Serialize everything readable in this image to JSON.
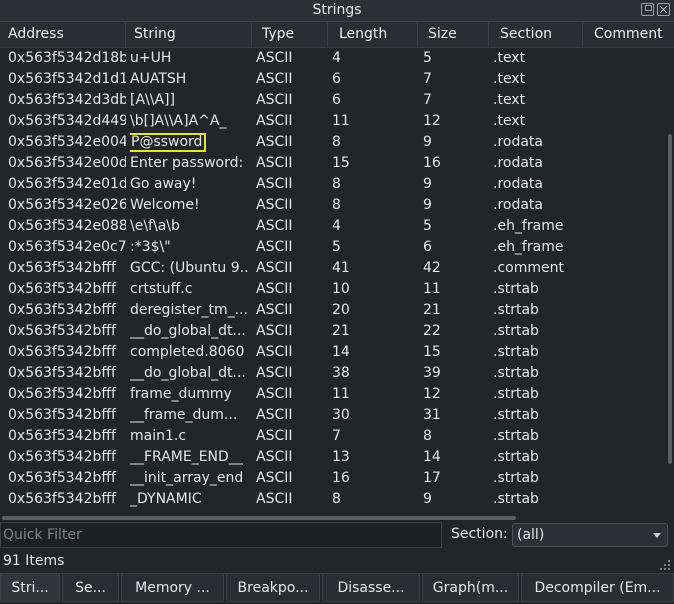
{
  "window": {
    "title": "Strings"
  },
  "columns": {
    "address": "Address",
    "string": "String",
    "type": "Type",
    "length": "Length",
    "size": "Size",
    "section": "Section",
    "comment": "Comment"
  },
  "rows": [
    {
      "address": "0x563f5342d18b",
      "string": "u+UH",
      "type": "ASCII",
      "length": "4",
      "size": "5",
      "section": ".text"
    },
    {
      "address": "0x563f5342d1d1",
      "string": "AUATSH",
      "type": "ASCII",
      "length": "6",
      "size": "7",
      "section": ".text"
    },
    {
      "address": "0x563f5342d3db",
      "string": "[A\\\\A]]",
      "type": "ASCII",
      "length": "6",
      "size": "7",
      "section": ".text"
    },
    {
      "address": "0x563f5342d449",
      "string": "\\b[]A\\\\A]A^A_",
      "type": "ASCII",
      "length": "11",
      "size": "12",
      "section": ".text"
    },
    {
      "address": "0x563f5342e004",
      "string": "P@ssword",
      "type": "ASCII",
      "length": "8",
      "size": "9",
      "section": ".rodata",
      "highlighted": true
    },
    {
      "address": "0x563f5342e00d",
      "string": "Enter password:",
      "type": "ASCII",
      "length": "15",
      "size": "16",
      "section": ".rodata"
    },
    {
      "address": "0x563f5342e01d",
      "string": "Go away!",
      "type": "ASCII",
      "length": "8",
      "size": "9",
      "section": ".rodata"
    },
    {
      "address": "0x563f5342e026",
      "string": "Welcome!",
      "type": "ASCII",
      "length": "8",
      "size": "9",
      "section": ".rodata"
    },
    {
      "address": "0x563f5342e088",
      "string": "\\e\\f\\a\\b",
      "type": "ASCII",
      "length": "4",
      "size": "5",
      "section": ".eh_frame"
    },
    {
      "address": "0x563f5342e0c7",
      "string": ":*3$\\\"",
      "type": "ASCII",
      "length": "5",
      "size": "6",
      "section": ".eh_frame"
    },
    {
      "address": "0x563f5342bfff",
      "string": "GCC: (Ubuntu 9...",
      "type": "ASCII",
      "length": "41",
      "size": "42",
      "section": ".comment"
    },
    {
      "address": "0x563f5342bfff",
      "string": "crtstuff.c",
      "type": "ASCII",
      "length": "10",
      "size": "11",
      "section": ".strtab"
    },
    {
      "address": "0x563f5342bfff",
      "string": "deregister_tm_...",
      "type": "ASCII",
      "length": "20",
      "size": "21",
      "section": ".strtab"
    },
    {
      "address": "0x563f5342bfff",
      "string": "__do_global_dt...",
      "type": "ASCII",
      "length": "21",
      "size": "22",
      "section": ".strtab"
    },
    {
      "address": "0x563f5342bfff",
      "string": "completed.8060",
      "type": "ASCII",
      "length": "14",
      "size": "15",
      "section": ".strtab"
    },
    {
      "address": "0x563f5342bfff",
      "string": "__do_global_dt...",
      "type": "ASCII",
      "length": "38",
      "size": "39",
      "section": ".strtab"
    },
    {
      "address": "0x563f5342bfff",
      "string": "frame_dummy",
      "type": "ASCII",
      "length": "11",
      "size": "12",
      "section": ".strtab"
    },
    {
      "address": "0x563f5342bfff",
      "string": "__frame_dum...",
      "type": "ASCII",
      "length": "30",
      "size": "31",
      "section": ".strtab"
    },
    {
      "address": "0x563f5342bfff",
      "string": "main1.c",
      "type": "ASCII",
      "length": "7",
      "size": "8",
      "section": ".strtab"
    },
    {
      "address": "0x563f5342bfff",
      "string": "__FRAME_END__",
      "type": "ASCII",
      "length": "13",
      "size": "14",
      "section": ".strtab"
    },
    {
      "address": "0x563f5342bfff",
      "string": "__init_array_end",
      "type": "ASCII",
      "length": "16",
      "size": "17",
      "section": ".strtab"
    },
    {
      "address": "0x563f5342bfff",
      "string": "_DYNAMIC",
      "type": "ASCII",
      "length": "8",
      "size": "9",
      "section": ".strtab"
    }
  ],
  "filter": {
    "placeholder": "Quick Filter",
    "section_label": "Section:",
    "section_value": "(all)"
  },
  "status": {
    "item_count": "91 Items"
  },
  "tabs": [
    "Stri...",
    "Se...",
    "Memory ...",
    "Breakpo...",
    "Disasse...",
    "Graph(m...",
    "Decompiler (Em..."
  ],
  "colors": {
    "highlight_border": "#e5e52d",
    "background": "#232629"
  }
}
